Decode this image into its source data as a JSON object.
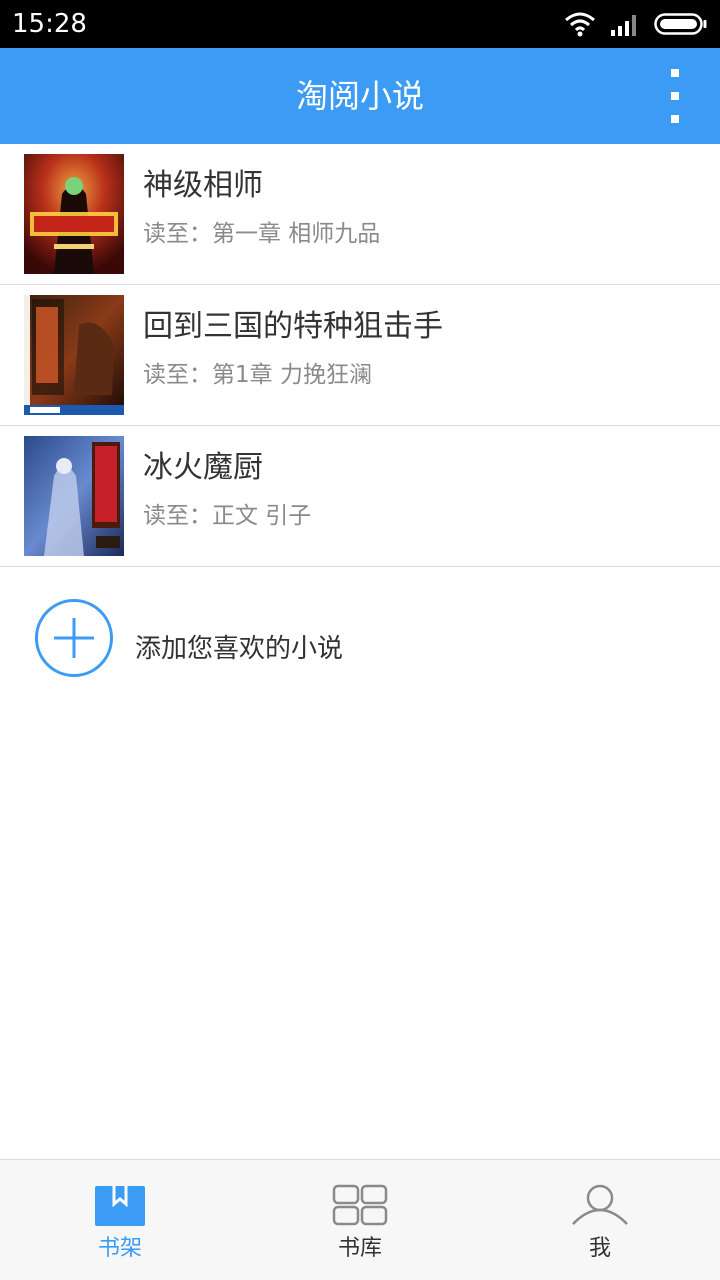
{
  "status_bar": {
    "time": "15:28"
  },
  "header": {
    "title": "淘阅小说",
    "more_icon": "more-vertical-icon"
  },
  "books": [
    {
      "title": "神级相师",
      "progress": "读至：第一章 相师九品",
      "cover": "book-cover-image"
    },
    {
      "title": "回到三国的特种狙击手",
      "progress": "读至：第1章 力挽狂澜",
      "cover": "book-cover-image"
    },
    {
      "title": "冰火魔厨",
      "progress": "读至：正文 引子",
      "cover": "book-cover-image"
    }
  ],
  "add_book": {
    "label": "添加您喜欢的小说",
    "icon": "plus-circle-icon"
  },
  "bottom_nav": {
    "tabs": [
      {
        "label": "书架",
        "icon": "bookshelf-icon",
        "active": true
      },
      {
        "label": "书库",
        "icon": "grid-icon",
        "active": false
      },
      {
        "label": "我",
        "icon": "user-icon",
        "active": false
      }
    ]
  },
  "colors": {
    "accent": "#3b9bf5",
    "text": "#333333",
    "subtext": "#8a8a8a"
  }
}
